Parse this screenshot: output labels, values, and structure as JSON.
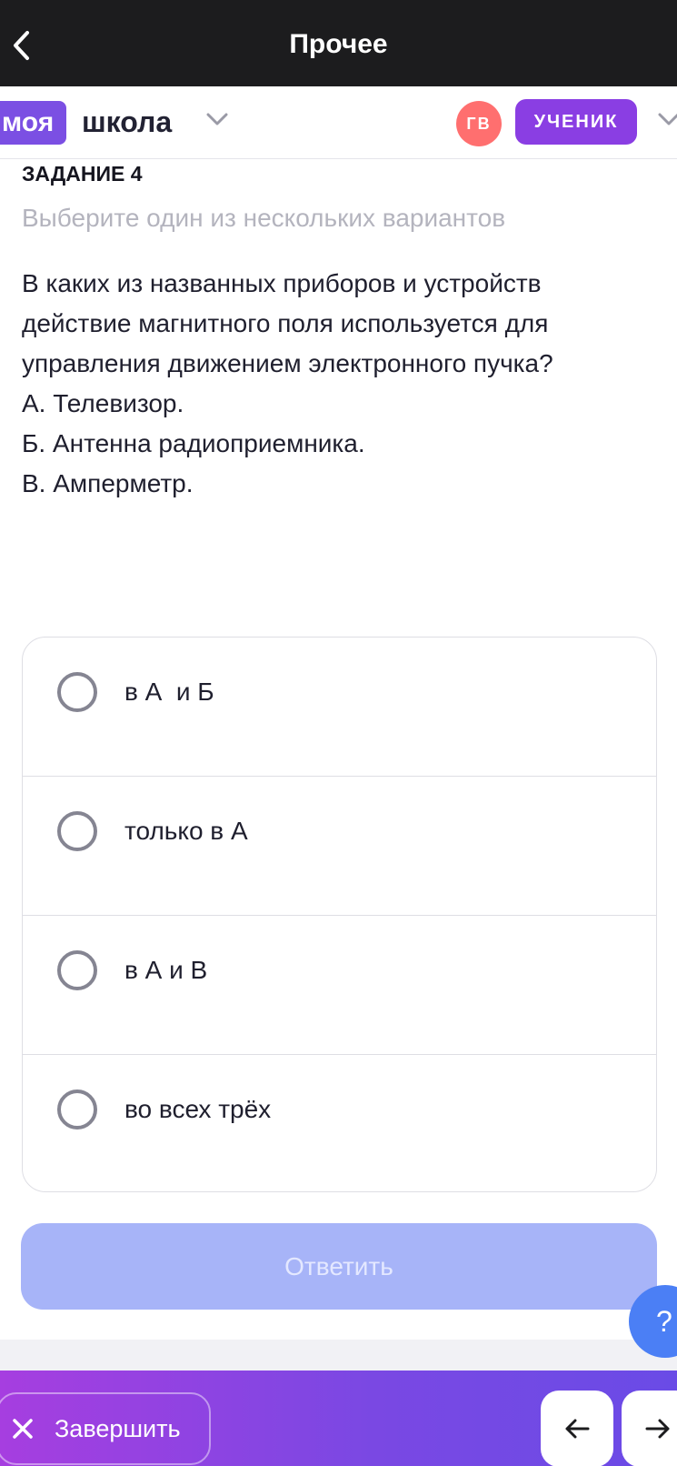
{
  "topbar": {
    "title": "Прочее",
    "back_icon": "chevron-left-icon"
  },
  "header": {
    "logo_part1": "моя",
    "logo_part2": "школа",
    "avatar_initials": "ГВ",
    "role_label": "УЧЕНИК",
    "colors": {
      "logo_bg": "#7b4fe3",
      "avatar_bg": "#ff6f6f",
      "role_bg": "#8a3ee3"
    }
  },
  "task": {
    "label": "ЗАДАНИЕ 4",
    "hint": "Выберите один из нескольких вариантов",
    "question_lines": [
      "В каких из названных приборов и устройств",
      "действие магнитного поля используется для",
      "управления движением электронного пучка?",
      "А. Телевизор.",
      "Б. Антенна радиоприемника.",
      "В. Амперметр."
    ]
  },
  "options": [
    {
      "label": "в А  и Б",
      "selected": false
    },
    {
      "label": "только в А",
      "selected": false
    },
    {
      "label": "в А и В",
      "selected": false
    },
    {
      "label": "во всех трёх",
      "selected": false
    }
  ],
  "answer_button": {
    "label": "Ответить",
    "disabled": true,
    "color": "#a7b4f8"
  },
  "help_button": {
    "label": "?"
  },
  "bottom_bar": {
    "finish_label": "Завершить",
    "prev_icon": "arrow-left-icon",
    "next_icon": "arrow-right-icon"
  }
}
